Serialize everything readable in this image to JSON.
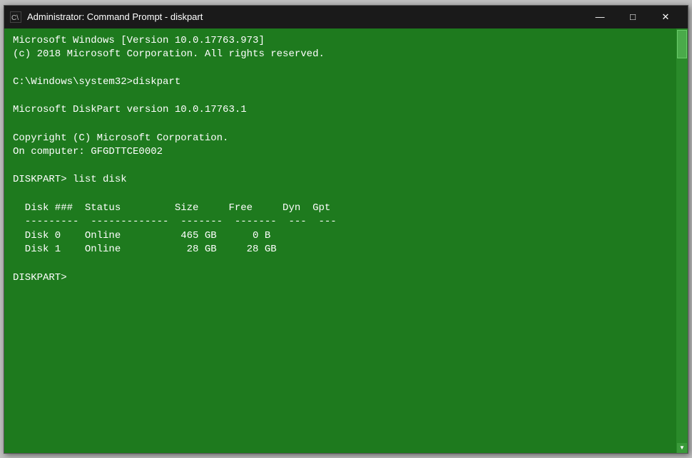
{
  "window": {
    "title": "Administrator: Command Prompt - diskpart",
    "icon_label": "cmd-icon"
  },
  "titlebar": {
    "minimize_label": "—",
    "maximize_label": "□",
    "close_label": "✕"
  },
  "console": {
    "line1": "Microsoft Windows [Version 10.0.17763.973]",
    "line2": "(c) 2018 Microsoft Corporation. All rights reserved.",
    "line3": "",
    "line4": "C:\\Windows\\system32>diskpart",
    "line5": "",
    "line6": "Microsoft DiskPart version 10.0.17763.1",
    "line7": "",
    "line8": "Copyright (C) Microsoft Corporation.",
    "line9": "On computer: GFGDTTCE0002",
    "line10": "",
    "line11": "DISKPART> list disk",
    "line12": "",
    "table_header": "  Disk ###  Status         Size     Free     Dyn  Gpt",
    "table_sep": "  ---------  -------------  -------  -------  ---  ---",
    "table_row1": "  Disk 0    Online          465 GB      0 B",
    "table_row2": "  Disk 1    Online           28 GB     28 GB",
    "line_after": "",
    "prompt_final": "DISKPART> "
  }
}
